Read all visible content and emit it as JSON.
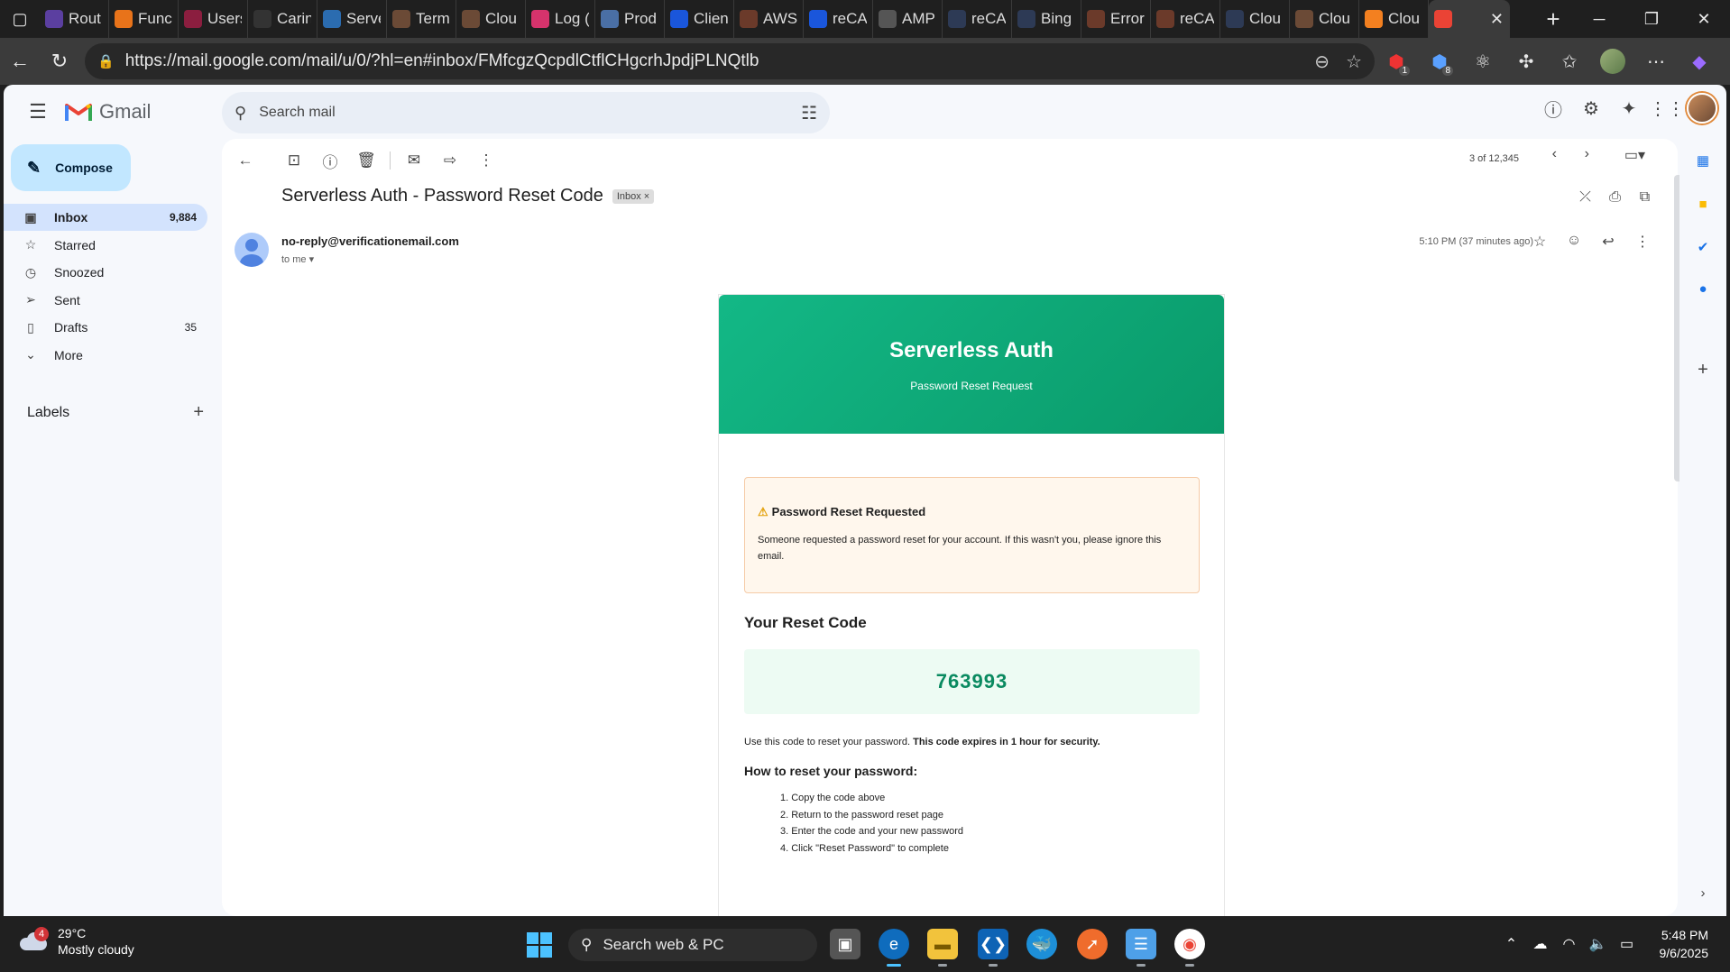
{
  "browser": {
    "tabs": [
      {
        "label": "Rout",
        "icon": "route-icon",
        "color": "#5b3fa0"
      },
      {
        "label": "Func",
        "icon": "lambda-icon",
        "color": "#e8731a"
      },
      {
        "label": "Users",
        "icon": "users-icon",
        "color": "#8b1e3f"
      },
      {
        "label": "Carin",
        "icon": "github-icon",
        "color": "#333333"
      },
      {
        "label": "Serve",
        "icon": "react-icon",
        "color": "#2b6cb0"
      },
      {
        "label": "Term",
        "icon": "cloudflare-icon",
        "color": "#6b4a36"
      },
      {
        "label": "Clou",
        "icon": "cloudflare-icon",
        "color": "#6b4a36"
      },
      {
        "label": "Log (",
        "icon": "log-icon",
        "color": "#d6336c"
      },
      {
        "label": "Prod",
        "icon": "prod-icon",
        "color": "#4a6fa5"
      },
      {
        "label": "Clien",
        "icon": "shield-icon",
        "color": "#1a56db"
      },
      {
        "label": "AWS",
        "icon": "aws-icon",
        "color": "#6b3a2a"
      },
      {
        "label": "reCA",
        "icon": "recaptcha-icon",
        "color": "#1a56db"
      },
      {
        "label": "AMP",
        "icon": "amp-icon",
        "color": "#555555"
      },
      {
        "label": "reCA",
        "icon": "search-icon",
        "color": "#2d3a55"
      },
      {
        "label": "Bing",
        "icon": "search-icon",
        "color": "#2d3a55"
      },
      {
        "label": "Error",
        "icon": "error-icon",
        "color": "#6b3a2a"
      },
      {
        "label": "reCA",
        "icon": "aws-icon",
        "color": "#6b3a2a"
      },
      {
        "label": "Clou",
        "icon": "search-icon",
        "color": "#2d3a55"
      },
      {
        "label": "Clou",
        "icon": "cloudflare-icon",
        "color": "#6b4a36"
      },
      {
        "label": "Clou",
        "icon": "cloudflare-icon",
        "color": "#f38020"
      },
      {
        "label": "",
        "icon": "gmail-icon",
        "color": "#ea4335",
        "active": true
      }
    ],
    "url": "https://mail.google.com/mail/u/0/?hl=en#inbox/FMfcgzQcpdlCtflCHgcrhJpdjPLNQtlb",
    "ext_badges": [
      "1",
      "8"
    ]
  },
  "gmail": {
    "logo_text": "Gmail",
    "search_placeholder": "Search mail",
    "compose_label": "Compose",
    "nav": [
      {
        "label": "Inbox",
        "count": "9,884",
        "icon": "inbox-icon",
        "active": true
      },
      {
        "label": "Starred",
        "count": "",
        "icon": "star-icon"
      },
      {
        "label": "Snoozed",
        "count": "",
        "icon": "clock-icon"
      },
      {
        "label": "Sent",
        "count": "",
        "icon": "send-icon"
      },
      {
        "label": "Drafts",
        "count": "35",
        "icon": "draft-icon"
      },
      {
        "label": "More",
        "count": "",
        "icon": "chevron-down-icon"
      }
    ],
    "labels_title": "Labels",
    "pager": "3 of 12,345",
    "subject": "Serverless Auth - Password Reset Code",
    "label_chip": "Inbox",
    "from": "no-reply@verificationemail.com",
    "to": "to me",
    "time": "5:10 PM (37 minutes ago)"
  },
  "email": {
    "brand": "Serverless Auth",
    "hero_subtitle": "Password Reset Request",
    "warning_title": "Password Reset Requested",
    "warning_body": "Someone requested a password reset for your account. If this wasn't you, please ignore this email.",
    "code_title": "Your Reset Code",
    "code": "763993",
    "use_text": "Use this code to reset your password.",
    "use_bold": "This code expires in 1 hour for security.",
    "how_title": "How to reset your password:",
    "steps": [
      "1. Copy the code above",
      "2. Return to the password reset page",
      "3. Enter the code and your new password",
      "4. Click \"Reset Password\" to complete"
    ]
  },
  "taskbar": {
    "weather_badge": "4",
    "temperature": "29°C",
    "condition": "Mostly cloudy",
    "search_label": "Search web & PC",
    "time": "5:48 PM",
    "date": "9/6/2025"
  },
  "colors": {
    "accent": "#0b57d0",
    "hero_green": "#13b886",
    "code_green": "#0a8a60",
    "inbox_highlight": "#d3e3fd",
    "compose_bg": "#c2e7ff"
  }
}
